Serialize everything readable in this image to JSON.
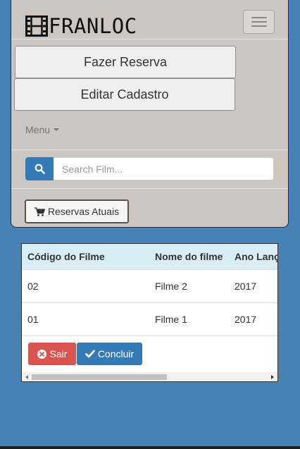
{
  "brand": {
    "name": "FRANLOC",
    "icon": "film-icon"
  },
  "nav": {
    "toggle_icon": "hamburger-icon",
    "fazer_reserva": "Fazer Reserva",
    "editar_cadastro": "Editar Cadastro",
    "menu_label": "Menu",
    "search": {
      "placeholder": "Search Film...",
      "value": "",
      "icon": "search-icon"
    },
    "reservas_atuais": {
      "label": "Reservas Atuais",
      "icon": "cart-icon"
    }
  },
  "table": {
    "headers": [
      "Código do Filme",
      "Nome do filme",
      "Ano Lanç"
    ],
    "rows": [
      [
        "02",
        "Filme 2",
        "2017"
      ],
      [
        "01",
        "Filme 1",
        "2017"
      ]
    ],
    "actions": {
      "sair": {
        "label": "Sair",
        "icon": "circle-x-icon"
      },
      "concluir": {
        "label": "Concluir",
        "icon": "checkmark-icon"
      }
    }
  },
  "colors": {
    "background": "#4682b4",
    "navbar": "#cdc5bf",
    "table_header": "#d9edf7",
    "danger": "#d9534f",
    "primary": "#337ab7"
  }
}
